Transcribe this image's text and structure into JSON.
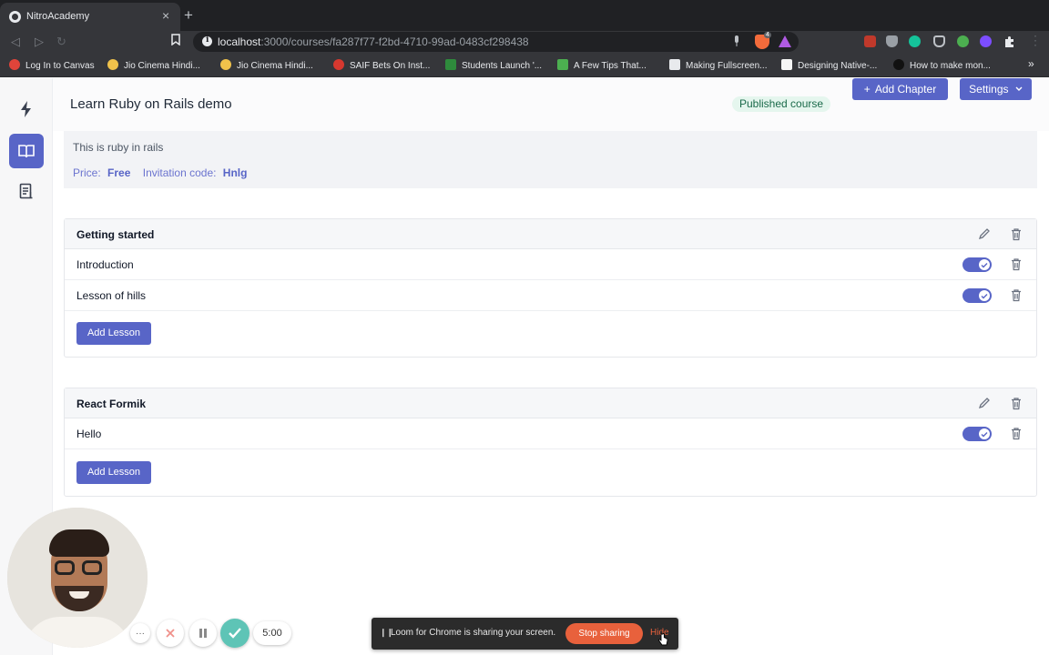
{
  "browser": {
    "tab_title": "NitroAcademy",
    "tab_close": "×",
    "new_tab": "+",
    "url_host": "localhost",
    "url_path": ":3000/courses/fa287f77-f2bd-4710-99ad-0483cf298438",
    "brave_badge": "4",
    "bookmarks": [
      {
        "label": "Log In to Canvas",
        "icon_color": "#e0443a"
      },
      {
        "label": "Jio Cinema Hindi...",
        "icon_color": "#f0c24b"
      },
      {
        "label": "Jio Cinema Hindi...",
        "icon_color": "#f0c24b"
      },
      {
        "label": "SAIF Bets On Inst...",
        "icon_color": "#d6382f"
      },
      {
        "label": "Students Launch '...",
        "icon_color": "#2e8b3c"
      },
      {
        "label": "A Few Tips That...",
        "icon_color": "#4caf50"
      },
      {
        "label": "Making Fullscreen...",
        "icon_color": "#e8eaed"
      },
      {
        "label": "Designing Native-...",
        "icon_color": "#111111"
      },
      {
        "label": "How to make mon...",
        "icon_color": "#222222"
      }
    ],
    "bookmarks_more": "»"
  },
  "header": {
    "title": "Learn Ruby on Rails demo",
    "status_badge": "Published course",
    "add_chapter_label": "Add Chapter",
    "add_chapter_icon": "+",
    "settings_label": "Settings"
  },
  "course": {
    "description": "This is ruby in rails",
    "price_label": "Price:",
    "price_value": "Free",
    "invitation_label": "Invitation code:",
    "invitation_value": "Hnlg"
  },
  "chapters": [
    {
      "title": "Getting started",
      "lessons": [
        {
          "title": "Introduction",
          "published": true
        },
        {
          "title": "Lesson of hills",
          "published": true
        }
      ],
      "add_lesson_label": "Add Lesson"
    },
    {
      "title": "React Formik",
      "lessons": [
        {
          "title": "Hello",
          "published": true
        }
      ],
      "add_lesson_label": "Add Lesson"
    }
  ],
  "loom": {
    "more_label": "···",
    "timer": "5:00",
    "share_text": "Loom for Chrome is sharing your screen.",
    "stop_label": "Stop sharing",
    "hide_label": "Hide"
  },
  "colors": {
    "primary": "#5865c7",
    "published_bg": "#e5f6ee",
    "loom_orange": "#e8613c",
    "loom_check": "#5ec4b6"
  }
}
